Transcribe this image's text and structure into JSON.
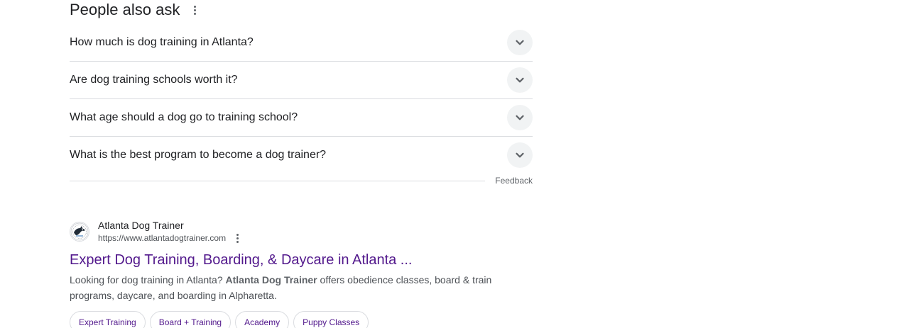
{
  "paa": {
    "title": "People also ask",
    "questions": [
      "How much is dog training in Atlanta?",
      "Are dog training schools worth it?",
      "What age should a dog go to training school?",
      "What is the best program to become a dog trainer?"
    ],
    "feedback": "Feedback"
  },
  "result": {
    "site_name": "Atlanta Dog Trainer",
    "url": "https://www.atlantadogtrainer.com",
    "title": "Expert Dog Training, Boarding, & Daycare in Atlanta ...",
    "snippet_before": "Looking for dog training in Atlanta? ",
    "snippet_bold": "Atlanta Dog Trainer",
    "snippet_after": " offers obedience classes, board & train programs, daycare, and boarding in Alpharetta.",
    "chips": [
      "Expert Training",
      "Board + Training",
      "Academy",
      "Puppy Classes"
    ]
  },
  "colors": {
    "visited_link": "#52188c",
    "text": "#202124",
    "muted": "#4d5156",
    "divider": "#dadce0"
  },
  "icons": {
    "paa_menu": "more-vert-icon",
    "expand": "chevron-down-icon",
    "result_menu": "more-vert-icon",
    "favicon": "site-favicon"
  }
}
